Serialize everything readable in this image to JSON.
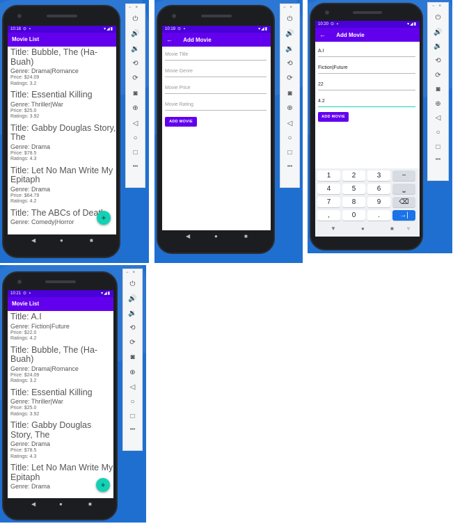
{
  "status": {
    "time_1": "10:18",
    "time_2": "10:19",
    "time_3": "10:20",
    "time_4": "10:21",
    "dots": "⊙ ▪",
    "icons": "▾◢▮"
  },
  "list_title": "Movie List",
  "add_title": "Add Movie",
  "back_icon": "←",
  "fab_label": "+",
  "nav": {
    "back": "◀",
    "home": "●",
    "recent": "■"
  },
  "movies_before": [
    {
      "title": "Title: Bubble, The (Ha-Buah)",
      "genre": "Genre: Drama|Romance",
      "price": "Price: $24.09",
      "rating": "Ratings: 3.2"
    },
    {
      "title": "Title: Essential Killing",
      "genre": "Genre: Thriller|War",
      "price": "Price: $25.0",
      "rating": "Ratings: 3.92"
    },
    {
      "title": "Title: Gabby Douglas Story, The",
      "genre": "Genre: Drama",
      "price": "Price: $78.5",
      "rating": "Ratings: 4.3"
    },
    {
      "title": "Title: Let No Man Write My Epitaph",
      "genre": "Genre: Drama",
      "price": "Price: $64.79",
      "rating": "Ratings: 4.2"
    },
    {
      "title": "Title: The ABCs of Death",
      "genre": "Genre: Comedy|Horror",
      "price": "",
      "rating": ""
    }
  ],
  "movies_after": [
    {
      "title": "Title: A.I",
      "genre": "Genre: Fiction|Future",
      "price": "Price: $22.0",
      "rating": "Ratings: 4.2"
    },
    {
      "title": "Title: Bubble, The (Ha-Buah)",
      "genre": "Genre: Drama|Romance",
      "price": "Price: $24.09",
      "rating": "Ratings: 3.2"
    },
    {
      "title": "Title: Essential Killing",
      "genre": "Genre: Thriller|War",
      "price": "Price: $25.0",
      "rating": "Ratings: 3.92"
    },
    {
      "title": "Title: Gabby Douglas Story, The",
      "genre": "Genre: Drama",
      "price": "Price: $78.5",
      "rating": "Ratings: 4.3"
    },
    {
      "title": "Title: Let No Man Write My Epitaph",
      "genre": "Genre: Drama",
      "price": "",
      "rating": ""
    }
  ],
  "form": {
    "title_placeholder": "Movie Title",
    "genre_placeholder": "Movie Genre",
    "price_placeholder": "Movie Price",
    "rating_placeholder": "Movie Rating",
    "button": "ADD MOVIE",
    "title_value": "A.I",
    "genre_value": "Fiction|Future",
    "price_value": "22",
    "rating_value": "4.2"
  },
  "keypad": {
    "rows": [
      [
        "1",
        "2",
        "3",
        "−"
      ],
      [
        "4",
        "5",
        "6",
        "⎵"
      ],
      [
        "7",
        "8",
        "9",
        "⌫"
      ],
      [
        ",",
        "0",
        ".",
        "→|"
      ]
    ],
    "nav": [
      "▼",
      "●",
      "■",
      "▿"
    ]
  },
  "toolbar": {
    "minimize": "−",
    "close": "×",
    "power": "⏻",
    "vol_up": "🔊",
    "vol_down": "🔉",
    "rotate_left": "⟲",
    "rotate_right": "⟳",
    "camera": "◙",
    "zoom": "⊕",
    "back": "◁",
    "home": "○",
    "overview": "□",
    "more": "•••"
  }
}
